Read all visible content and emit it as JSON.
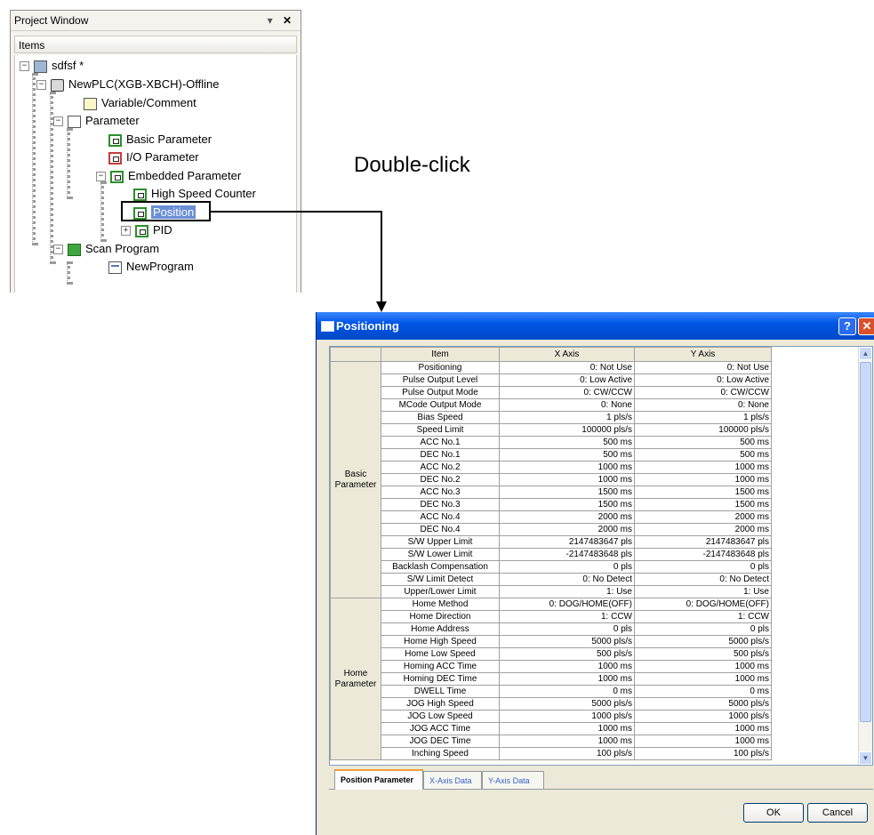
{
  "project_window": {
    "title": "Project Window",
    "controls": "▾",
    "close": "✕",
    "items_header": "Items",
    "tree": {
      "project": "sdfsf *",
      "plc": "NewPLC(XGB-XBCH)-Offline",
      "variable_comment": "Variable/Comment",
      "parameter": "Parameter",
      "basic_parameter": "Basic Parameter",
      "io_parameter": "I/O Parameter",
      "embedded_parameter": "Embedded Parameter",
      "high_speed_counter": "High Speed Counter",
      "position": "Position",
      "pid": "PID",
      "scan_program": "Scan Program",
      "new_program": "NewProgram"
    },
    "expanders": {
      "minus": "−",
      "plus": "+"
    }
  },
  "annotation": {
    "double_click": "Double-click"
  },
  "dialog": {
    "title": "Positioning",
    "help": "?",
    "close": "✕",
    "columns": {
      "item": "Item",
      "x_axis": "X Axis",
      "y_axis": "Y Axis"
    },
    "groups": {
      "basic": "Basic Parameter",
      "home": "Home Parameter"
    },
    "rows_basic": [
      {
        "item": "Positioning",
        "x": "0: Not Use",
        "y": "0: Not Use"
      },
      {
        "item": "Pulse Output Level",
        "x": "0: Low Active",
        "y": "0: Low Active"
      },
      {
        "item": "Pulse Output Mode",
        "x": "0: CW/CCW",
        "y": "0: CW/CCW"
      },
      {
        "item": "MCode Output Mode",
        "x": "0: None",
        "y": "0: None"
      },
      {
        "item": "Bias Speed",
        "x": "1 pls/s",
        "y": "1 pls/s"
      },
      {
        "item": "Speed Limit",
        "x": "100000 pls/s",
        "y": "100000 pls/s"
      },
      {
        "item": "ACC No.1",
        "x": "500 ms",
        "y": "500 ms"
      },
      {
        "item": "DEC No.1",
        "x": "500 ms",
        "y": "500 ms"
      },
      {
        "item": "ACC No.2",
        "x": "1000 ms",
        "y": "1000 ms"
      },
      {
        "item": "DEC No.2",
        "x": "1000 ms",
        "y": "1000 ms"
      },
      {
        "item": "ACC No.3",
        "x": "1500 ms",
        "y": "1500 ms"
      },
      {
        "item": "DEC No.3",
        "x": "1500 ms",
        "y": "1500 ms"
      },
      {
        "item": "ACC No.4",
        "x": "2000 ms",
        "y": "2000 ms"
      },
      {
        "item": "DEC No.4",
        "x": "2000 ms",
        "y": "2000 ms"
      },
      {
        "item": "S/W Upper Limit",
        "x": "2147483647 pls",
        "y": "2147483647 pls"
      },
      {
        "item": "S/W Lower Limit",
        "x": "-2147483648 pls",
        "y": "-2147483648 pls"
      },
      {
        "item": "Backlash Compensation",
        "x": "0 pls",
        "y": "0 pls"
      },
      {
        "item": "S/W Limit Detect",
        "x": "0: No Detect",
        "y": "0: No Detect"
      },
      {
        "item": "Upper/Lower Limit",
        "x": "1: Use",
        "y": "1: Use"
      }
    ],
    "rows_home": [
      {
        "item": "Home Method",
        "x": "0: DOG/HOME(OFF)",
        "y": "0: DOG/HOME(OFF)"
      },
      {
        "item": "Home Direction",
        "x": "1: CCW",
        "y": "1: CCW"
      },
      {
        "item": "Home Address",
        "x": "0 pls",
        "y": "0 pls"
      },
      {
        "item": "Home High Speed",
        "x": "5000 pls/s",
        "y": "5000 pls/s"
      },
      {
        "item": "Home Low Speed",
        "x": "500 pls/s",
        "y": "500 pls/s"
      },
      {
        "item": "Homing ACC Time",
        "x": "1000 ms",
        "y": "1000 ms"
      },
      {
        "item": "Homing DEC Time",
        "x": "1000 ms",
        "y": "1000 ms"
      },
      {
        "item": "DWELL Time",
        "x": "0 ms",
        "y": "0 ms"
      },
      {
        "item": "JOG High Speed",
        "x": "5000 pls/s",
        "y": "5000 pls/s"
      },
      {
        "item": "JOG Low Speed",
        "x": "1000 pls/s",
        "y": "1000 pls/s"
      },
      {
        "item": "JOG ACC Time",
        "x": "1000 ms",
        "y": "1000 ms"
      },
      {
        "item": "JOG DEC Time",
        "x": "1000 ms",
        "y": "1000 ms"
      },
      {
        "item": "Inching Speed",
        "x": "100 pls/s",
        "y": "100 pls/s"
      }
    ],
    "scroll": {
      "up": "▲",
      "down": "▼"
    },
    "tabs": [
      "Position Parameter",
      "X-Axis Data",
      "Y-Axis Data"
    ],
    "buttons": {
      "ok": "OK",
      "cancel": "Cancel"
    }
  }
}
